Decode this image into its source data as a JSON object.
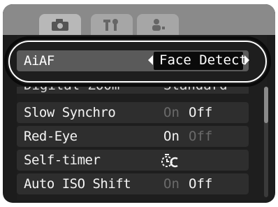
{
  "tabs": [
    {
      "icon": "camera-icon"
    },
    {
      "icon": "tools-icon"
    },
    {
      "icon": "person-icon"
    }
  ],
  "menu": {
    "selected": {
      "label": "AiAF",
      "value": "Face Detect"
    },
    "partial_row": {
      "label": "Digital Zoom",
      "value": "Standard"
    },
    "items": [
      {
        "label": "Slow Synchro",
        "on": "On",
        "off": "Off",
        "active": "off"
      },
      {
        "label": "Red-Eye",
        "on": "On",
        "off": "Off",
        "active": "on"
      },
      {
        "label": "Self-timer",
        "value_icon": "self-timer-icon"
      },
      {
        "label": "Auto ISO Shift",
        "on": "On",
        "off": "Off",
        "active": "off"
      }
    ]
  },
  "colors": {
    "screen_bg": "#1c1c1c",
    "row_bg": "#2e2e2e",
    "selected_bg": "#5a5a5a",
    "tab_bar": "#8a8a8a"
  }
}
